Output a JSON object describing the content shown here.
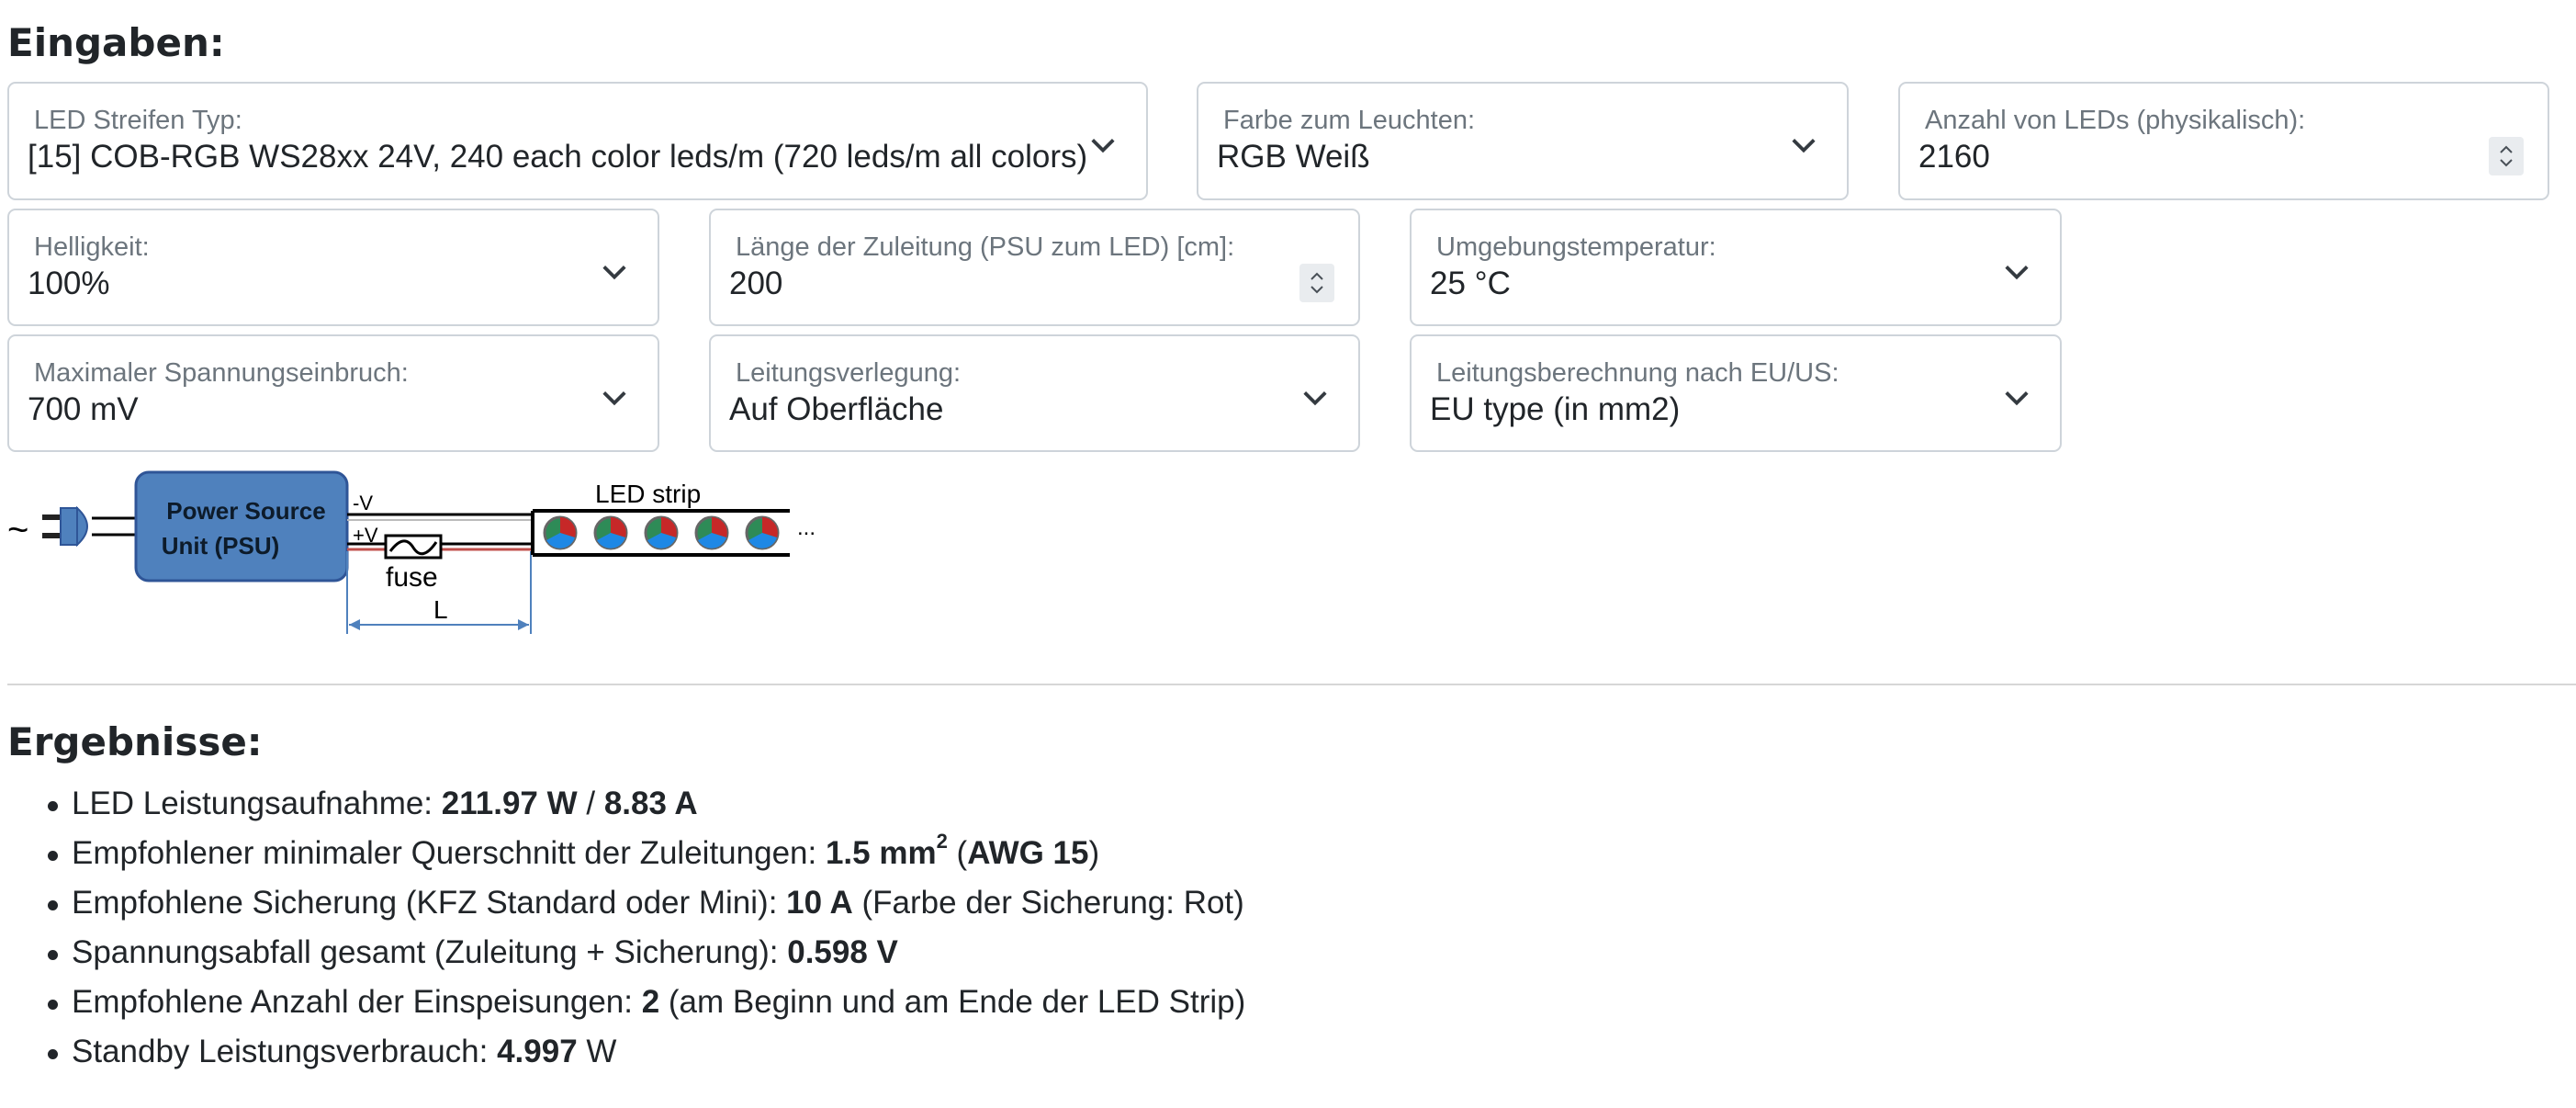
{
  "inputs": {
    "heading": "Eingaben:",
    "strip_type": {
      "label": "LED Streifen Typ:",
      "value": "[15] COB-RGB WS28xx 24V, 240 each color leds/m (720 leds/m all colors)"
    },
    "color": {
      "label": "Farbe zum Leuchten:",
      "value": "RGB Weiß"
    },
    "led_count": {
      "label": "Anzahl von LEDs (physikalisch):",
      "value": "2160"
    },
    "brightness": {
      "label": "Helligkeit:",
      "value": "100%"
    },
    "lead_length": {
      "label": "Länge der Zuleitung (PSU zum LED) [cm]:",
      "value": "200"
    },
    "ambient_temp": {
      "label": "Umgebungstemperatur:",
      "value": "25 °C"
    },
    "max_drop": {
      "label": "Maximaler Spannungseinbruch:",
      "value": "700 mV"
    },
    "routing": {
      "label": "Leitungsverlegung:",
      "value": "Auf Oberfläche"
    },
    "standard": {
      "label": "Leitungsberechnung nach EU/US:",
      "value": "EU type (in mm2)"
    }
  },
  "diagram": {
    "ac_symbol": "~",
    "psu_label_line1": "Power Source",
    "psu_label_line2": "Unit (PSU)",
    "neg_label": "-V",
    "pos_label": "+V",
    "fuse_label": "fuse",
    "length_label": "L",
    "strip_label": "LED strip",
    "ellipsis": "..."
  },
  "results": {
    "heading": "Ergebnisse:",
    "power": {
      "label": "LED Leistungsaufnahme: ",
      "watts": "211.97 W",
      "sep": " / ",
      "amps": "8.83 A"
    },
    "cross_section": {
      "label": "Empfohlener minimaler Querschnitt der Zuleitungen: ",
      "value": "1.5 mm",
      "sup": "2",
      "open": " (",
      "awg": "AWG 15",
      "close": ")"
    },
    "fuse": {
      "label": "Empfohlene Sicherung (KFZ Standard oder Mini): ",
      "value": "10 A",
      "note": " (Farbe der Sicherung: Rot)"
    },
    "voltage_drop": {
      "label": "Spannungsabfall gesamt (Zuleitung + Sicherung): ",
      "value": "0.598 V"
    },
    "feeds": {
      "label": "Empfohlene Anzahl der Einspeisungen: ",
      "value": "2",
      "note": " (am Beginn und am Ende der LED Strip)"
    },
    "standby": {
      "label": "Standby Leistungsverbrauch: ",
      "value": "4.997",
      "unit": " W"
    }
  }
}
